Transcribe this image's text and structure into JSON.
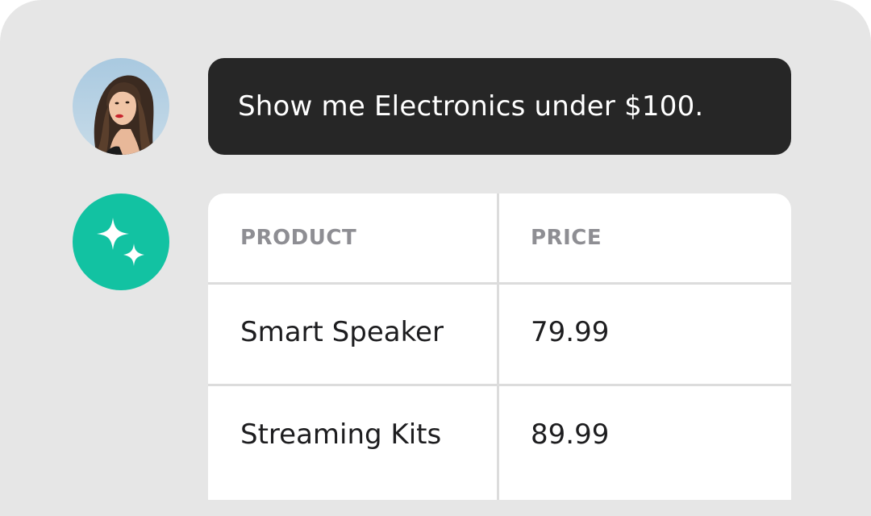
{
  "user_message": {
    "text": "Show me Electronics under $100."
  },
  "assistant_table": {
    "headers": [
      "PRODUCT",
      "PRICE"
    ],
    "rows": [
      {
        "product": "Smart Speaker",
        "price": "79.99"
      },
      {
        "product": "Streaming Kits",
        "price": "89.99"
      }
    ]
  },
  "colors": {
    "background": "#e6e6e6",
    "user_bubble": "#262626",
    "assistant_icon": "#12c2a2",
    "table_bg": "#ffffff",
    "header_text": "#8e8e93"
  },
  "icons": {
    "user": "user-avatar-photo",
    "assistant": "sparkles-icon"
  }
}
